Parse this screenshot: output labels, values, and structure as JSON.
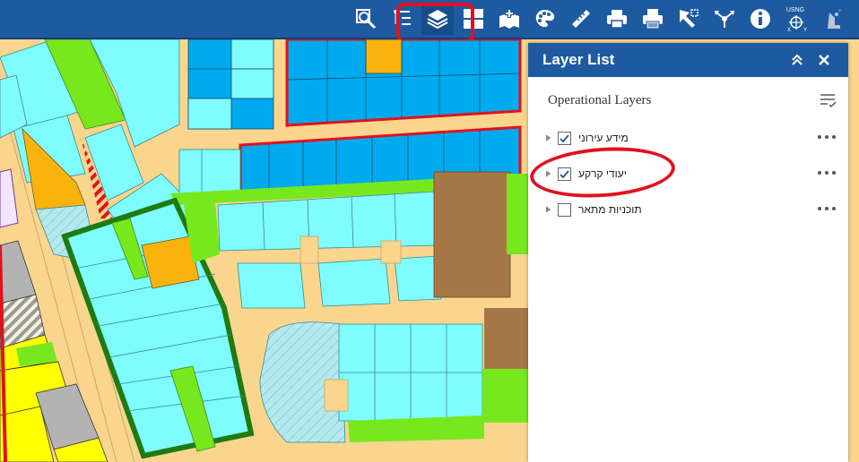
{
  "toolbar": {
    "tools": [
      {
        "id": "search",
        "icon": "zoom-search-icon"
      },
      {
        "id": "legend",
        "icon": "legend-list-icon"
      },
      {
        "id": "layers",
        "icon": "layers-icon",
        "active": true
      },
      {
        "id": "basemap",
        "icon": "basemap-grid-icon"
      },
      {
        "id": "addData",
        "icon": "add-data-icon"
      },
      {
        "id": "palette",
        "icon": "palette-icon"
      },
      {
        "id": "measure",
        "icon": "ruler-icon"
      },
      {
        "id": "print",
        "icon": "printer-icon"
      },
      {
        "id": "printReport",
        "icon": "print-report-icon"
      },
      {
        "id": "select",
        "icon": "select-tool-icon"
      },
      {
        "id": "share",
        "icon": "share-icon"
      },
      {
        "id": "about",
        "icon": "info-icon"
      },
      {
        "id": "coordinates",
        "icon": "usng-coordinates-icon",
        "label_top": "USNG",
        "label_x": "X",
        "label_y": "Y"
      },
      {
        "id": "scalebar",
        "icon": "scale-tool-icon"
      }
    ],
    "colors": {
      "bar": "#1e5aa0",
      "highlight": "#e3101e"
    }
  },
  "panel": {
    "title": "Layer List",
    "section": "Operational Layers",
    "layers": [
      {
        "label": "מידע עירוני",
        "checked": true
      },
      {
        "label": "יעודי קרקע",
        "checked": true
      },
      {
        "label": "תוכניות מתאר",
        "checked": false
      }
    ]
  },
  "map": {
    "colors": {
      "road": "#f9d58e",
      "residential": "#7ffcff",
      "public": "#00aaef",
      "green": "#78e81e",
      "orange": "#f9b30c",
      "brown": "#a57747",
      "yellow": "#ffff00",
      "gray": "#b3b3b3",
      "border_red": "#e3101e",
      "dark_green": "#1f7a12"
    }
  }
}
